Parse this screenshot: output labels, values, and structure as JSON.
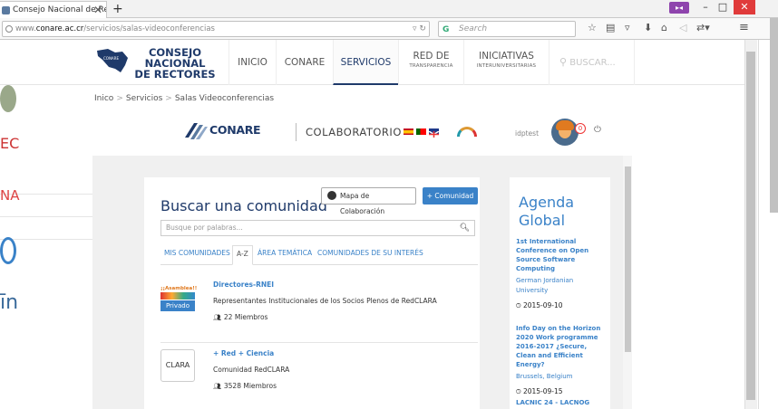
{
  "browser": {
    "tab_title": "Consejo Nacional de Rect...",
    "tab_close": "✕",
    "new_tab": "+",
    "url_prefix": "www.",
    "url_host": "conare.ac.cr",
    "url_path": "/servicios/salas-videoconferencias",
    "search_placeholder": "Search",
    "window_minimize": "–",
    "window_maximize": "□",
    "window_close": "✕"
  },
  "site": {
    "logo_line1": "CONSEJO NACIONAL",
    "logo_line2": "DE RECTORES",
    "nav": [
      {
        "label": "INICIO",
        "sub": ""
      },
      {
        "label": "CONARE",
        "sub": ""
      },
      {
        "label": "SERVICIOS",
        "sub": ""
      },
      {
        "label": "RED DE",
        "sub": "TRANSPARENCIA"
      },
      {
        "label": "INICIATIVAS",
        "sub": "INTERUNIVERSITARIAS"
      }
    ],
    "search_label": "BUSCAR...",
    "breadcrumb": [
      "Inico",
      "Servicios",
      "Salas Videoconferencias"
    ],
    "breadcrumb_sep": ">"
  },
  "app": {
    "brand": "CONARE",
    "title": "COLABORATORIO",
    "username": "idptest",
    "notif_count": "0",
    "card": {
      "title": "Buscar una comunidad",
      "mapa_button": "Mapa de Colaboración",
      "comunidad_button": "+ Comunidad",
      "search_placeholder": "Busque por palabras...",
      "tabs": [
        "MIS COMUNIDADES",
        "A-Z",
        "ÁREA TEMÁTICA",
        "COMUNIDADES DE SU INTERÉS"
      ],
      "items": [
        {
          "name": "Directores-RNEI",
          "desc": "Representantes Institucionales de los Socios Plenos de RedCLARA",
          "members": "22 Miembros",
          "logo_text": "¡¡Asamblea!!",
          "badge": "Privado"
        },
        {
          "name": "+ Red + Ciencia",
          "desc": "Comunidad RedCLARA",
          "members": "3528 Miembros",
          "logo_text": "CLARA",
          "badge": ""
        }
      ]
    },
    "agenda": {
      "title": "Agenda Global",
      "events": [
        {
          "title": "1st International Conference on Open Source Software Computing",
          "place": "German Jordanian University",
          "date": "2015-09-10"
        },
        {
          "title": "Info Day on the Horizon 2020 Work programme 2016-2017 ¿Secure, Clean and Efficient Energy?",
          "place": "Brussels, Belgium",
          "date": "2015-09-15"
        },
        {
          "title": "LACNIC 24 - LACNOG",
          "place": "",
          "date": ""
        }
      ]
    }
  },
  "colors": {
    "brand": "#1f3a6a",
    "link": "#3a82c8",
    "close": "#e03b3b"
  }
}
